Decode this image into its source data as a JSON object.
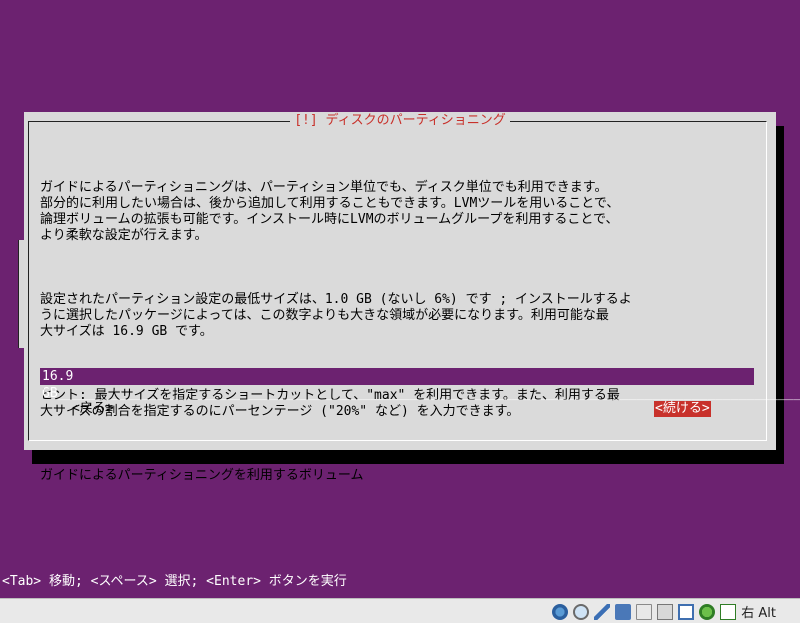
{
  "dialog": {
    "title": "[!] ディスクのパーティショニング",
    "paragraphs": [
      "ガイドによるパーティショニングは、パーティション単位でも、ディスク単位でも利用できます。\n部分的に利用したい場合は、後から追加して利用することもできます。LVMツールを用いることで、\n論理ボリュームの拡張も可能です。インストール時にLVMのボリュームグループを利用することで、\nより柔軟な設定が行えます。",
      "設定されたパーティション設定の最低サイズは、1.0 GB (ないし 6%) です ; インストールするよ\nうに選択したパッケージによっては、この数字よりも大きな領域が必要になります。利用可能な最\n大サイズは 16.9 GB です。",
      "ヒント: 最大サイズを指定するショートカットとして、\"max\" を利用できます。また、利用する最\n大サイズの割合を指定するのにパーセンテージ (\"20%\" など) を入力できます。",
      "ガイドによるパーティショニングを利用するボリューム"
    ],
    "input_value": "16.9 GB",
    "back_label": "<戻る>",
    "continue_label": "<続ける>"
  },
  "status_line": "<Tab> 移動; <スペース> 選択; <Enter> ボタンを実行",
  "taskbar": {
    "tray_icons": [
      "hard-disk-icon",
      "optical-drive-icon",
      "pen-icon",
      "network-icon",
      "shared-folder-icon",
      "usb-icon",
      "display-icon",
      "globe-icon",
      "mouse-integration-icon"
    ],
    "host_key_label": "右 Alt"
  },
  "colors": {
    "background": "#6c2270",
    "dialog": "#dadada",
    "accent": "#c8312b"
  }
}
